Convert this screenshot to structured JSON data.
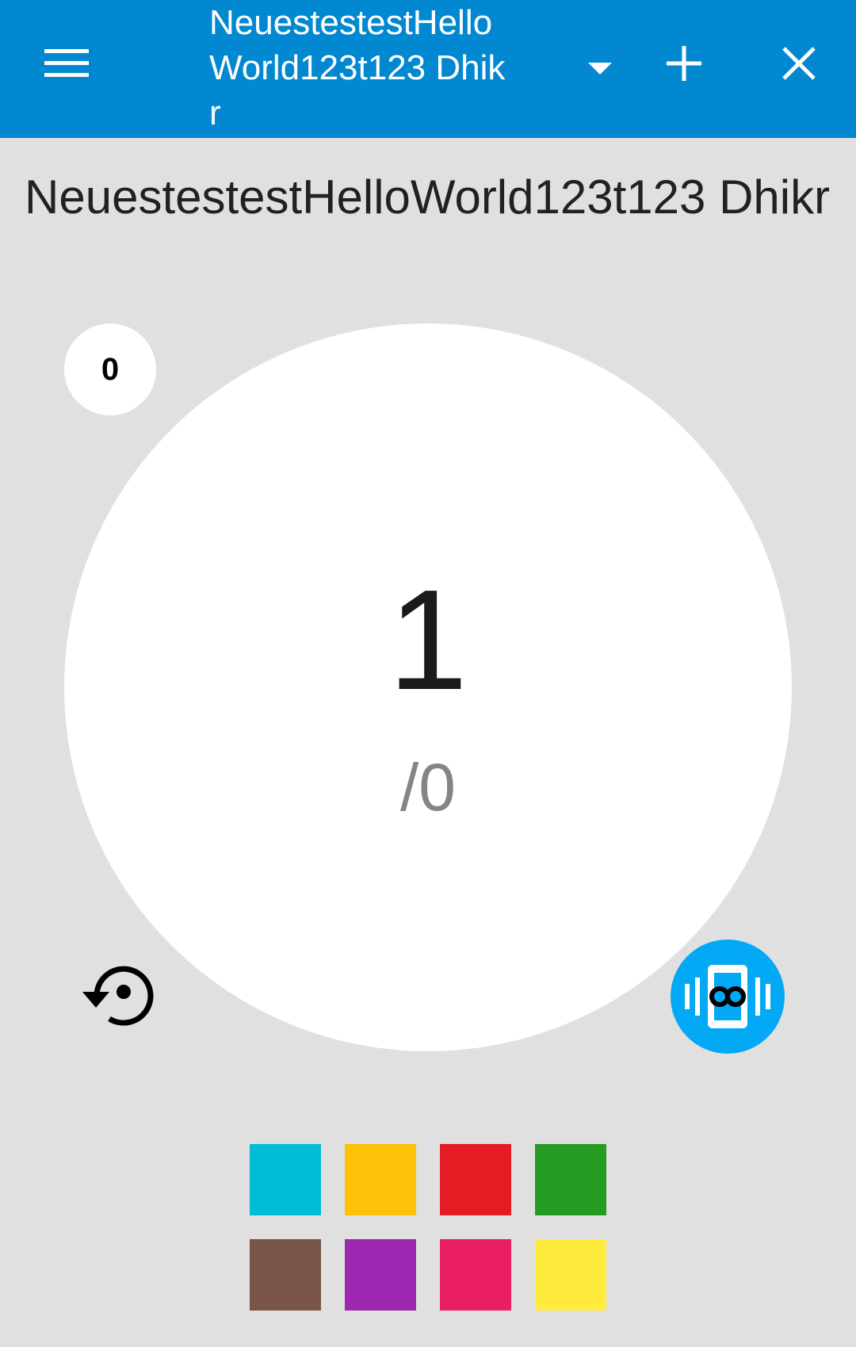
{
  "appbar": {
    "background_color": "#0288d1",
    "menu_icon": "hamburger-menu-icon",
    "title": "NeuestestestHelloWorld123t123 Dhikr",
    "dropdown_icon": "dropdown-arrow-icon",
    "add_icon": "plus-icon",
    "close_icon": "close-icon"
  },
  "main": {
    "heading": "NeuestestestHelloWorld123t123 Dhikr",
    "round_count": "0",
    "count": "1",
    "target": "/0",
    "reset_icon": "reset-history-icon",
    "vibrate_icon": "vibrate-infinite-icon",
    "vibrate_button_color": "#03a9f4"
  },
  "palette": {
    "colors": [
      "#00bcd4",
      "#ffc107",
      "#e51c23",
      "#259b24",
      "#795548",
      "#9c27b0",
      "#e91e63",
      "#ffeb3b"
    ]
  }
}
